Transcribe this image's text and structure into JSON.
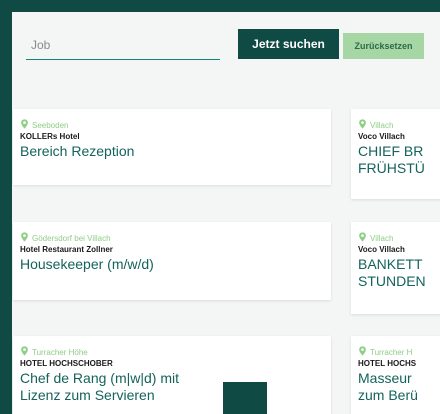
{
  "search": {
    "job_placeholder": "Job",
    "search_label": "Jetzt suchen",
    "reset_label": "Zurücksetzen"
  },
  "colors": {
    "frame": "#0f4a44",
    "accent": "#14635c",
    "location": "#8fce86",
    "reset_bg": "#a5d6a4"
  },
  "jobs": [
    {
      "location": "Seeboden",
      "company": "KOLLERs Hotel",
      "title": "Bereich Rezeption"
    },
    {
      "location": "Villach",
      "company": "Voco Villach",
      "title": "CHIEF BR\nFRÜHSTÜ"
    },
    {
      "location": "Gödersdorf bei Villach",
      "company": "Hotel Restaurant Zollner",
      "title": "Housekeeper (m/w/d)"
    },
    {
      "location": "Villach",
      "company": "Voco Villach",
      "title": "BANKETT\nSTUNDEN"
    },
    {
      "location": "Turracher Höhe",
      "company": "HOTEL HOCHSCHOBER",
      "title": "Chef de Rang (m|w|d) mit\nLizenz zum Servieren"
    },
    {
      "location": "Turracher H",
      "company": "HOTEL HOCHS",
      "title": "Masseur\nzum Berü"
    }
  ]
}
